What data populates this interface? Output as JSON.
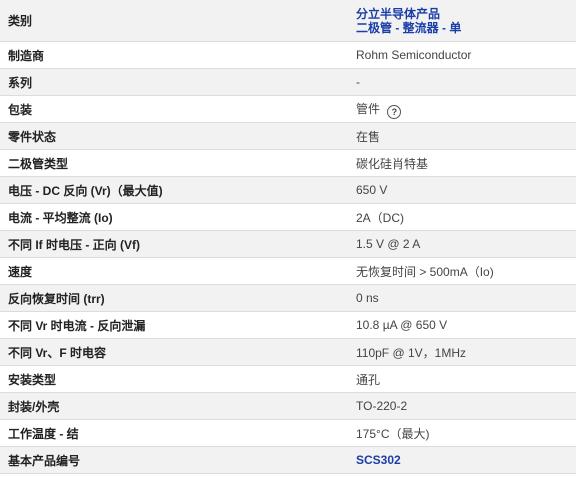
{
  "rows": [
    {
      "label": "类别",
      "links": [
        "分立半导体产品",
        "二极管 - 整流器 - 单"
      ]
    },
    {
      "label": "制造商",
      "value": "Rohm Semiconductor"
    },
    {
      "label": "系列",
      "value": "-"
    },
    {
      "label": "包装",
      "value": "管件",
      "icon": "help-circle-icon"
    },
    {
      "label": "零件状态",
      "value": "在售"
    },
    {
      "label": "二极管类型",
      "value": "碳化硅肖特基"
    },
    {
      "label": "电压 - DC 反向 (Vr)（最大值)",
      "value": "650 V"
    },
    {
      "label": "电流 - 平均整流 (Io)",
      "value": "2A（DC)"
    },
    {
      "label": "不同 If 时电压 - 正向 (Vf)",
      "value": "1.5 V @ 2 A"
    },
    {
      "label": "速度",
      "value": "无恢复时间 > 500mA（Io)"
    },
    {
      "label": "反向恢复时间 (trr)",
      "value": "0 ns"
    },
    {
      "label": "不同 Vr 时电流 - 反向泄漏",
      "value": "10.8 µA @ 650 V"
    },
    {
      "label": "不同 Vr、F 时电容",
      "value": "110pF @ 1V，1MHz"
    },
    {
      "label": "安装类型",
      "value": "通孔"
    },
    {
      "label": "封装/外壳",
      "value": "TO-220-2"
    },
    {
      "label": "工作温度 - 结",
      "value": "175°C（最大)"
    },
    {
      "label": "基本产品编号",
      "link": "SCS302"
    }
  ],
  "help_icon_glyph": "?",
  "colors": {
    "link": "#1a3ea8",
    "row_alt": "#f2f2f2",
    "border": "#dcdcdc"
  }
}
